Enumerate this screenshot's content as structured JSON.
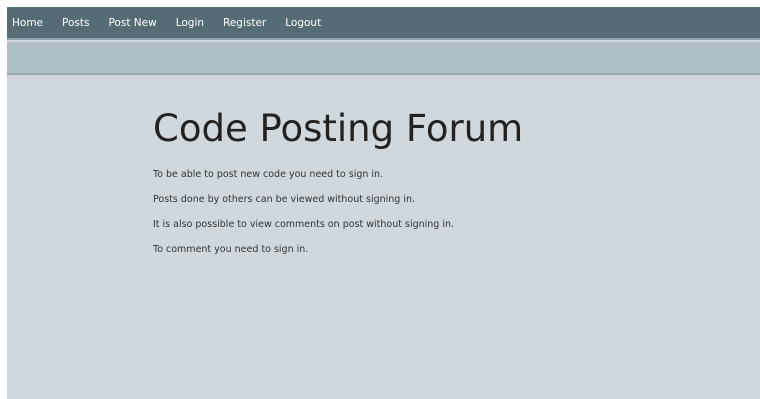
{
  "nav": {
    "items": [
      {
        "label": "Home"
      },
      {
        "label": "Posts"
      },
      {
        "label": "Post New"
      },
      {
        "label": "Login"
      },
      {
        "label": "Register"
      },
      {
        "label": "Logout"
      }
    ]
  },
  "main": {
    "title": "Code Posting Forum",
    "paragraphs": [
      "To be able to post new code you need to sign in.",
      "Posts done by others can be viewed without signing in.",
      "It is also possible to view comments on post without signing in.",
      "To comment you need to sign in."
    ]
  },
  "colors": {
    "navbar": "#556b75",
    "subbar": "#aebfc6",
    "page_background": "#d0d8de",
    "nav_text": "#ffffff",
    "title_text": "#222222"
  }
}
